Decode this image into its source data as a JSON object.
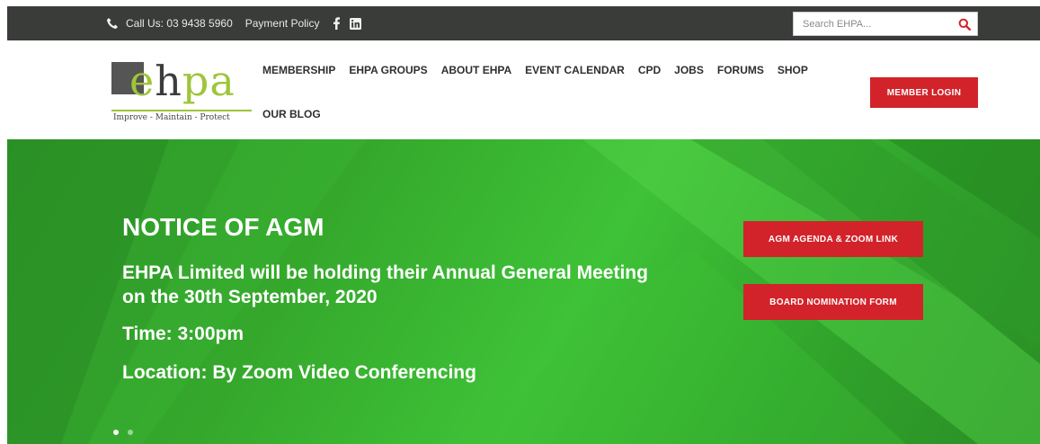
{
  "topbar": {
    "phone": "Call Us: 03 9438 5960",
    "payment_policy": "Payment Policy",
    "social": [
      "facebook-icon",
      "linkedin-icon"
    ],
    "search_placeholder": "Search EHPA..."
  },
  "logo": {
    "tagline": "Improve - Maintain - Protect"
  },
  "nav": {
    "items": [
      "MEMBERSHIP",
      "EHPA GROUPS",
      "ABOUT EHPA",
      "EVENT CALENDAR",
      "CPD",
      "JOBS",
      "FORUMS",
      "SHOP",
      "OUR BLOG"
    ]
  },
  "header": {
    "login_label": "MEMBER LOGIN"
  },
  "hero": {
    "title": "NOTICE OF AGM",
    "subtitle": "EHPA Limited will be holding their Annual General Meeting on the 30th September, 2020",
    "time": "Time: 3:00pm",
    "location": "Location: By Zoom Video Conferencing",
    "cta_primary": "AGM AGENDA & ZOOM LINK",
    "cta_secondary": "BOARD NOMINATION FORM",
    "slides": 2,
    "active_slide": 1
  },
  "colors": {
    "topbar_bg": "#3a3c39",
    "accent_red": "#d2232a",
    "brand_green": "#9ec53a",
    "hero_green": "#35a82c"
  }
}
